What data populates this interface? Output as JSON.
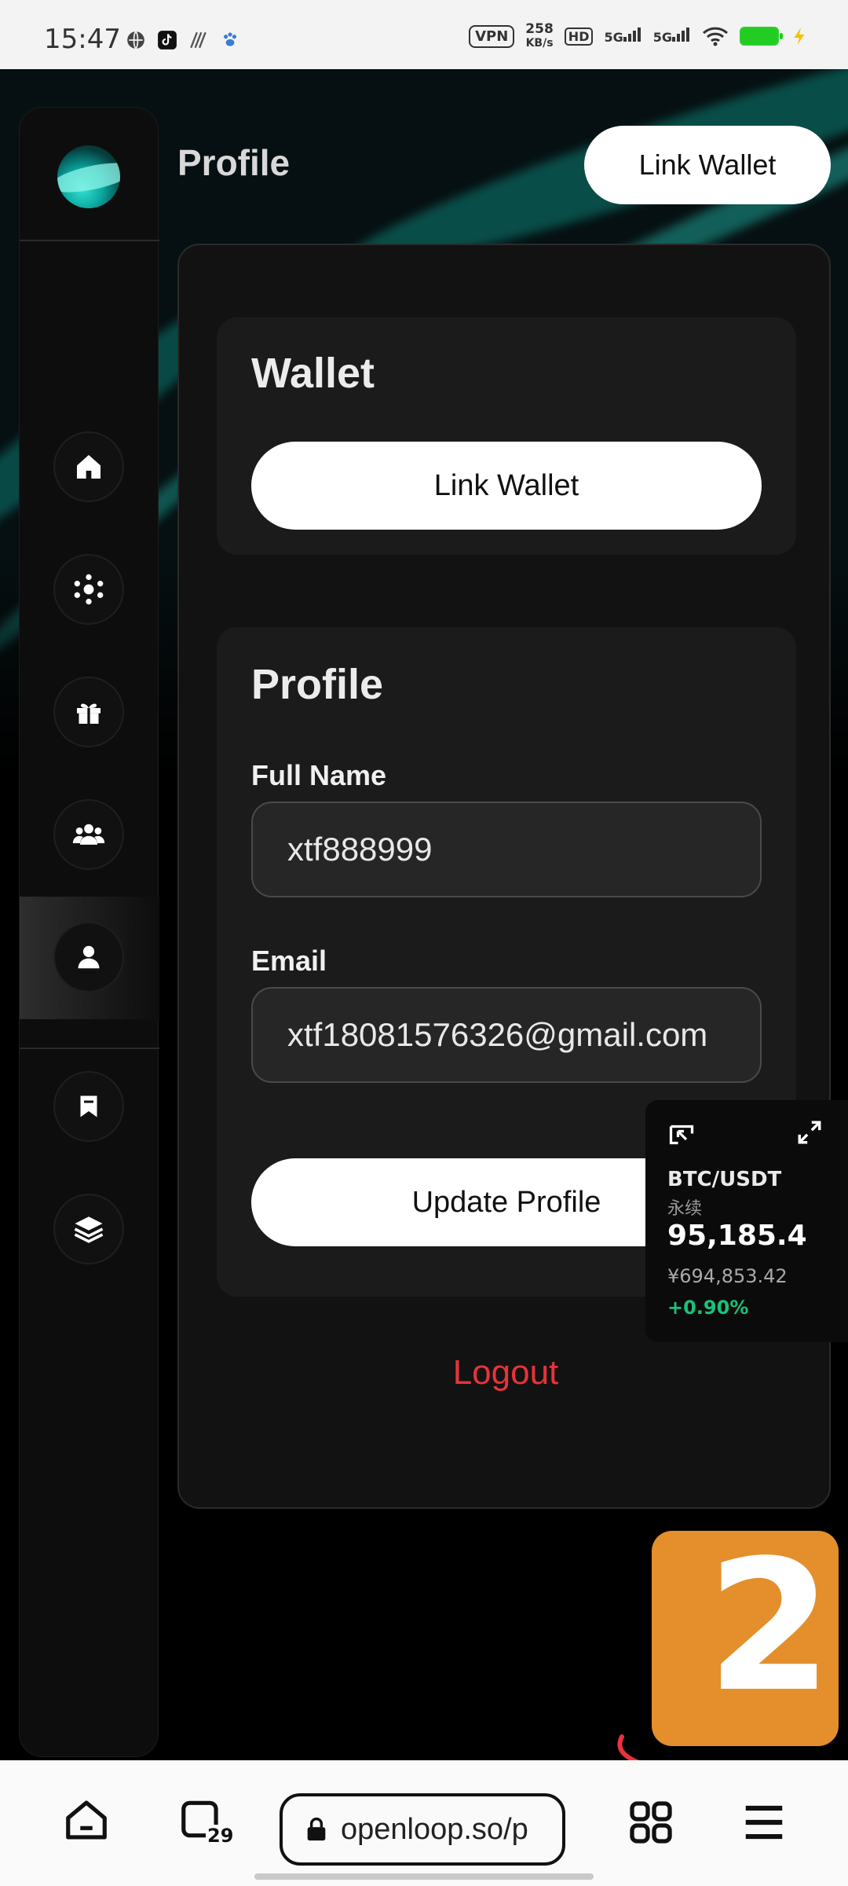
{
  "status_bar": {
    "time": "15:47",
    "vpn": "VPN",
    "speed_value": "258",
    "speed_unit": "KB/s",
    "hd": "HD",
    "sig1": "5G",
    "sig2": "5G"
  },
  "header": {
    "title": "Profile",
    "link_wallet_label": "Link Wallet"
  },
  "sidebar": {
    "items": [
      {
        "name": "home",
        "icon": "home-icon"
      },
      {
        "name": "network",
        "icon": "network-icon"
      },
      {
        "name": "rewards",
        "icon": "gift-icon"
      },
      {
        "name": "community",
        "icon": "users-icon"
      },
      {
        "name": "profile",
        "icon": "user-icon",
        "active": true
      },
      {
        "name": "saved",
        "icon": "bookmark-icon"
      },
      {
        "name": "layers",
        "icon": "layers-icon"
      }
    ]
  },
  "wallet_card": {
    "title": "Wallet",
    "button_label": "Link Wallet"
  },
  "profile_card": {
    "title": "Profile",
    "full_name_label": "Full Name",
    "full_name_value": "xtf888999",
    "email_label": "Email",
    "email_value": "xtf18081576326@gmail.com",
    "update_button_label": "Update Profile"
  },
  "logout_label": "Logout",
  "ticker": {
    "pair": "BTC/USDT",
    "subtitle": "永续",
    "price": "95,185.4",
    "cny_price": "¥694,853.42",
    "change": "+0.90%"
  },
  "badge": {
    "number": "2"
  },
  "browser_bar": {
    "url": "openloop.so/p",
    "tab_count": "29"
  },
  "colors": {
    "accent_teal": "#0aa7a0",
    "logout_red": "#e8333a",
    "change_green": "#19c27a",
    "badge_orange": "#e48f2c"
  }
}
